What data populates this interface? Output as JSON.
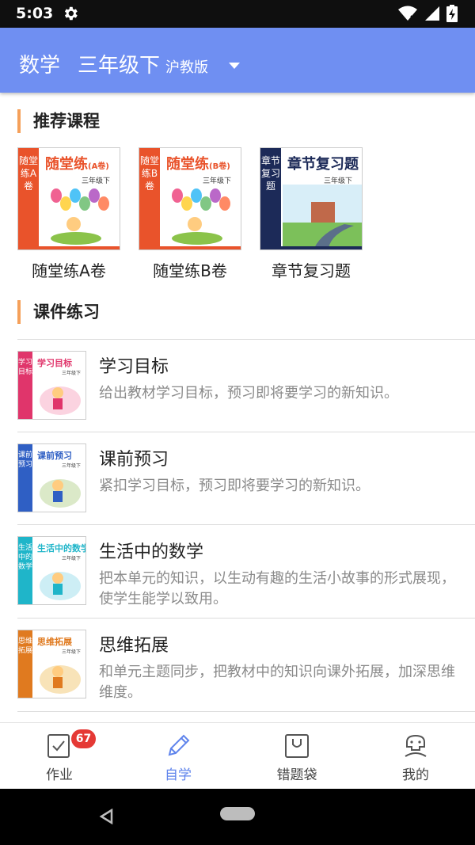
{
  "status_bar": {
    "time": "5:03",
    "icons": [
      "gear-icon",
      "wifi-icon",
      "signal-icon",
      "battery-charging-icon"
    ]
  },
  "app_bar": {
    "subject": "数学",
    "grade": "三年级下",
    "edition": "沪教版"
  },
  "sections": {
    "recommended": "推荐课程",
    "courseware": "课件练习"
  },
  "recommended": [
    {
      "label": "随堂练A卷",
      "cover_title": "随堂练",
      "cover_suffix": "(A卷)",
      "cover_grade": "三年级下",
      "spine": "随堂练A卷",
      "color": "#e9532b"
    },
    {
      "label": "随堂练B卷",
      "cover_title": "随堂练",
      "cover_suffix": "(B卷)",
      "cover_grade": "三年级下",
      "spine": "随堂练B卷",
      "color": "#e9532b"
    },
    {
      "label": "章节复习题",
      "cover_title": "章节复习题",
      "cover_suffix": "",
      "cover_grade": "三年级下",
      "spine": "章节复习题",
      "color": "#1c2a58"
    }
  ],
  "courseware": [
    {
      "title": "学习目标",
      "desc": "给出教材学习目标，预习即将要学习的新知识。",
      "cover_title": "学习目标",
      "cover_grade": "三年级下",
      "spine": "学习目标",
      "color": "#e0356b"
    },
    {
      "title": "课前预习",
      "desc": "紧扣学习目标，预习即将要学习的新知识。",
      "cover_title": "课前预习",
      "cover_grade": "三年级下",
      "spine": "课前预习",
      "color": "#2f5fc4"
    },
    {
      "title": "生活中的数学",
      "desc": "把本单元的知识，以生动有趣的生活小故事的形式展现，使学生能学以致用。",
      "cover_title": "生活中的数学",
      "cover_grade": "三年级下",
      "spine": "生活中的数学",
      "color": "#1fb5c9"
    },
    {
      "title": "思维拓展",
      "desc": "和单元主题同步，把教材中的知识向课外拓展，加深思维维度。",
      "cover_title": "思维拓展",
      "cover_grade": "三年级下",
      "spine": "思维拓展",
      "color": "#e07a1f"
    }
  ],
  "bottom_nav": [
    {
      "label": "作业",
      "icon": "homework-icon",
      "badge": "67",
      "active": false
    },
    {
      "label": "自学",
      "icon": "pencil-icon",
      "active": true
    },
    {
      "label": "错题袋",
      "icon": "bag-icon",
      "active": false
    },
    {
      "label": "我的",
      "icon": "profile-icon",
      "active": false
    }
  ],
  "colors": {
    "app_bar": "#6f8ff2",
    "accent": "#5f84ec",
    "section_marker": "#f5a05a",
    "badge": "#e53935"
  }
}
